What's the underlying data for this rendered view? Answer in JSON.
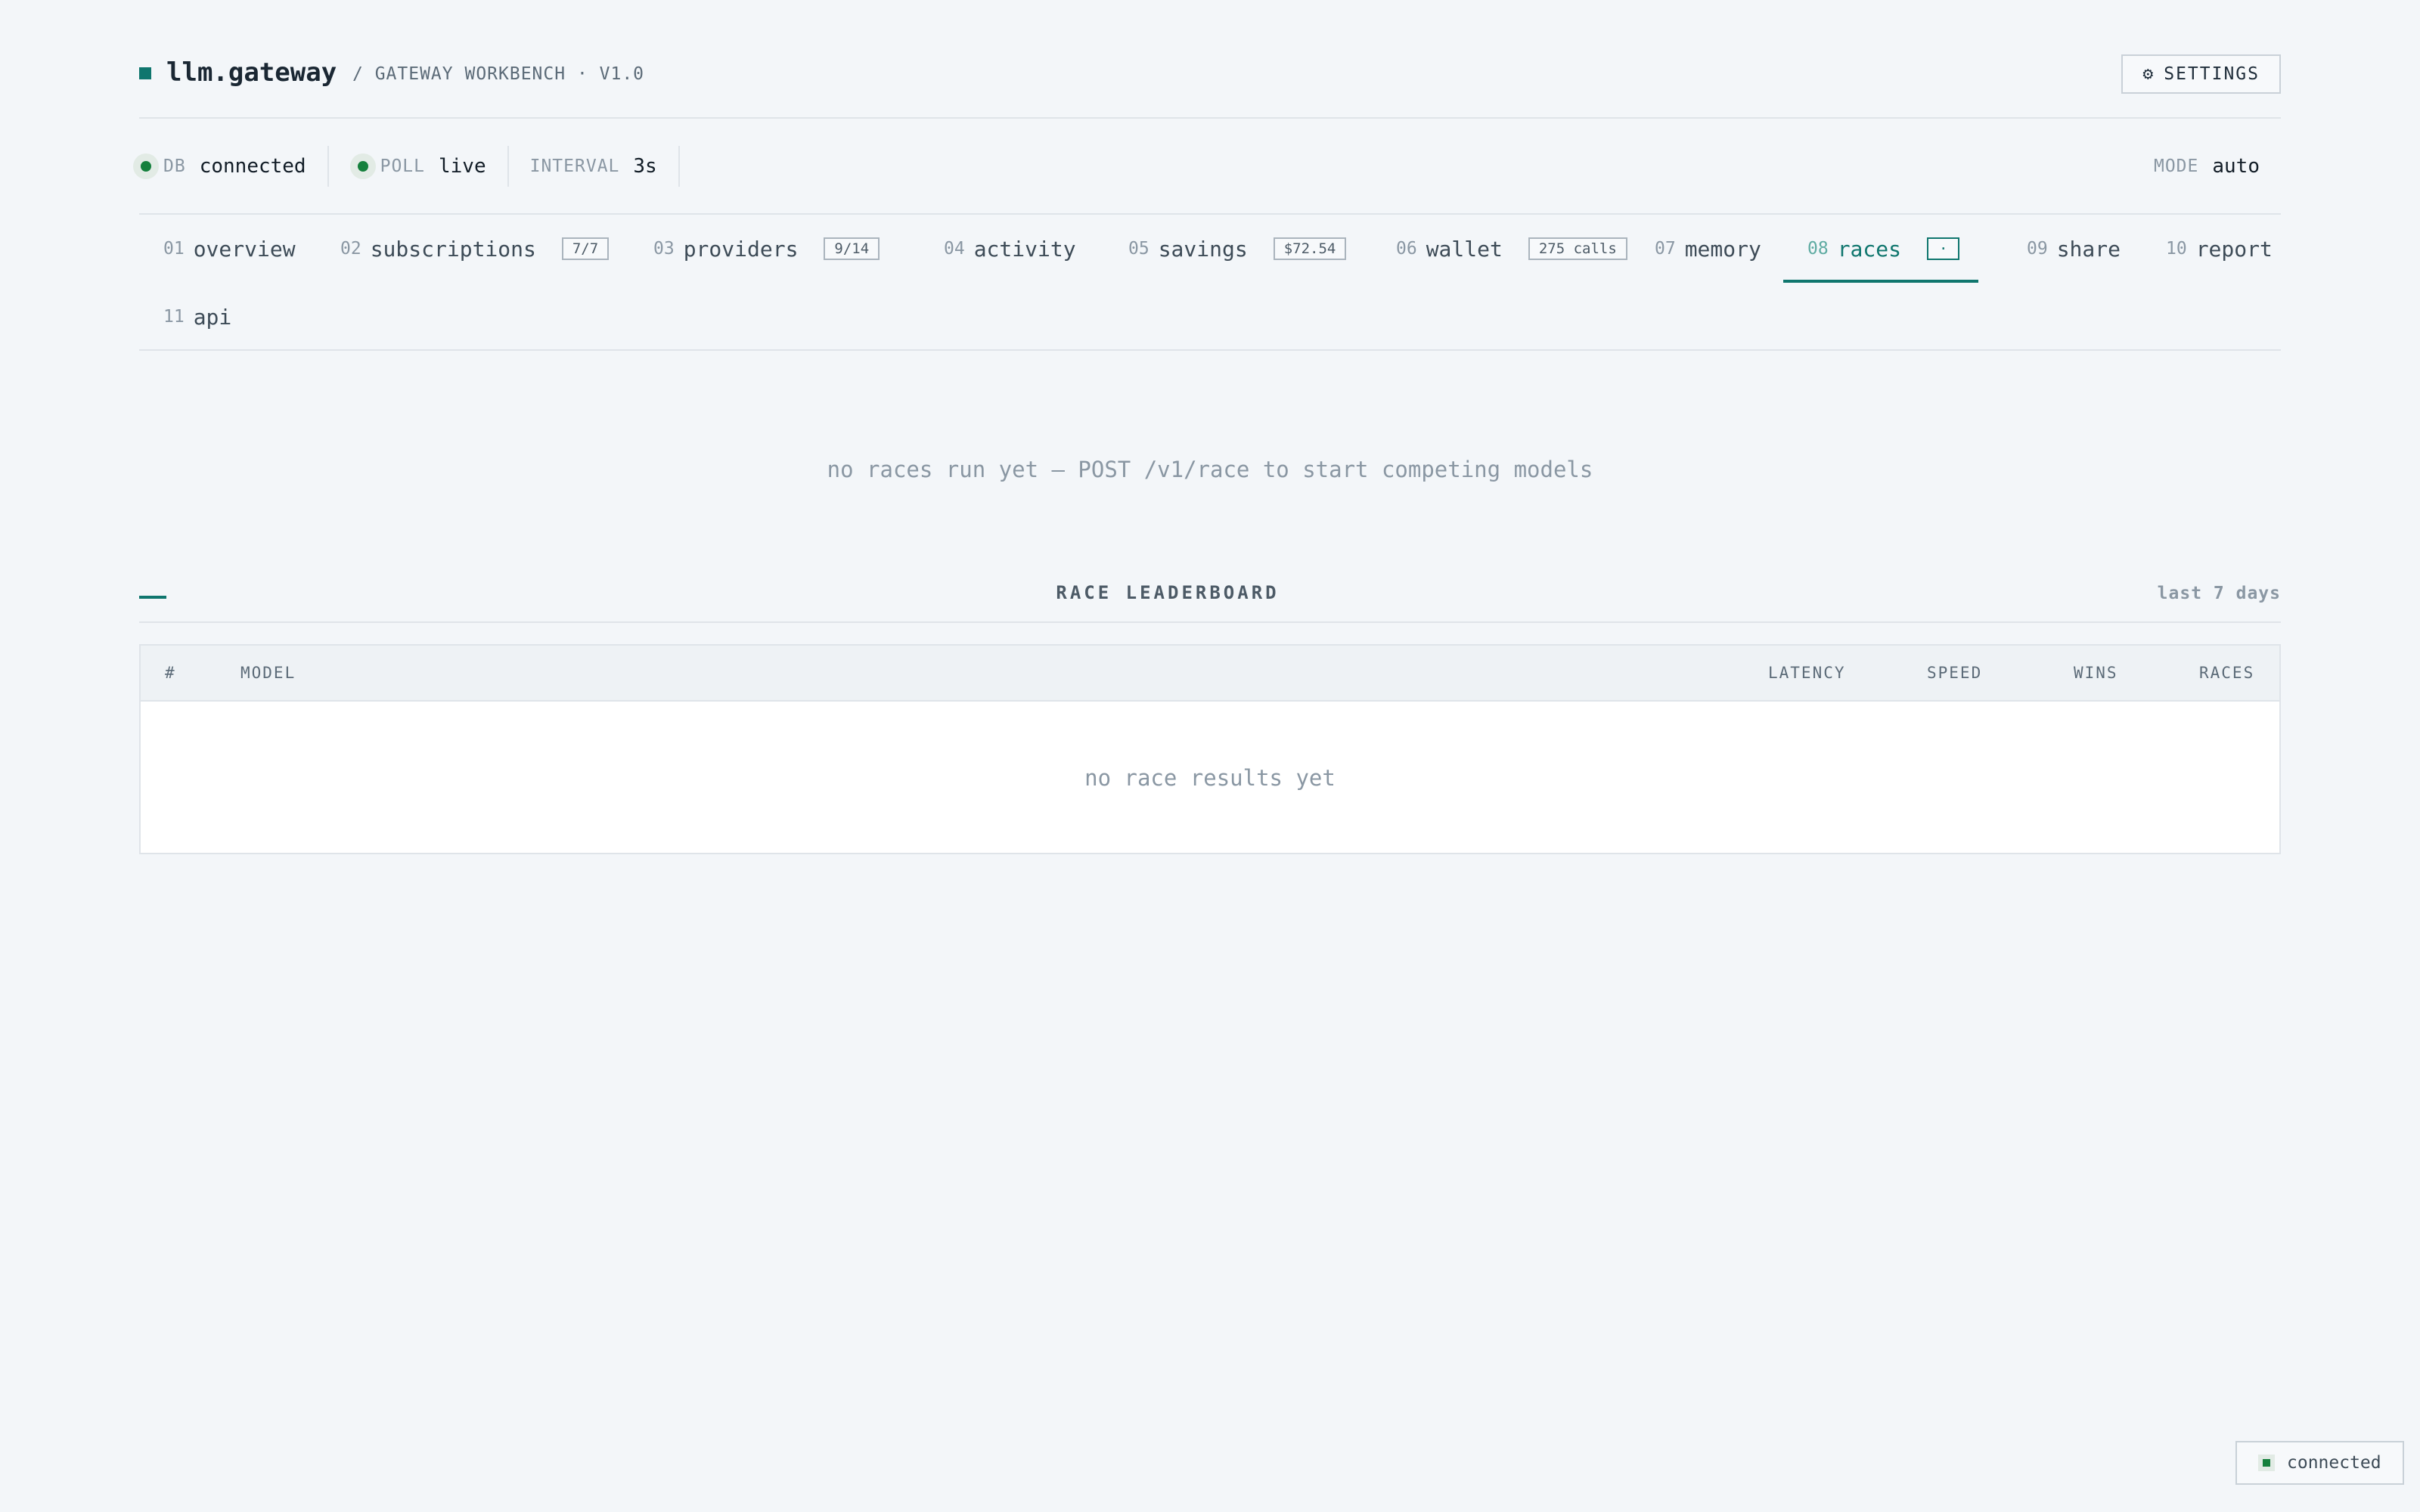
{
  "header": {
    "logo_icon": "square-icon",
    "app_name": "llm.gateway",
    "subtitle": "/ GATEWAY WORKBENCH · V1.0",
    "settings_icon": "gear-icon",
    "settings_glyph": "⚙",
    "settings_label": "SETTINGS"
  },
  "status": {
    "db": {
      "label": "DB",
      "value": "connected"
    },
    "poll": {
      "label": "POLL",
      "value": "live"
    },
    "interval": {
      "label": "INTERVAL",
      "value": "3s"
    },
    "mode": {
      "label": "MODE",
      "value": "auto"
    }
  },
  "tabs": [
    {
      "num": "01",
      "label": "overview",
      "badge": ""
    },
    {
      "num": "02",
      "label": "subscriptions",
      "badge": "7/7"
    },
    {
      "num": "03",
      "label": "providers",
      "badge": "9/14"
    },
    {
      "num": "04",
      "label": "activity",
      "badge": ""
    },
    {
      "num": "05",
      "label": "savings",
      "badge": "$72.54"
    },
    {
      "num": "06",
      "label": "wallet",
      "badge": "275 calls"
    },
    {
      "num": "07",
      "label": "memory",
      "badge": ""
    },
    {
      "num": "08",
      "label": "races",
      "badge": "·"
    },
    {
      "num": "09",
      "label": "share",
      "badge": ""
    },
    {
      "num": "10",
      "label": "report",
      "badge": ""
    },
    {
      "num": "11",
      "label": "api",
      "badge": ""
    }
  ],
  "active_tab": "races",
  "races": {
    "empty_message": "no races run yet — POST /v1/race to start competing models"
  },
  "leaderboard": {
    "title": "RACE LEADERBOARD",
    "range": "last 7 days",
    "columns": {
      "rank": "#",
      "model": "MODEL",
      "latency": "LATENCY",
      "speed": "SPEED",
      "wins": "WINS",
      "races": "RACES"
    },
    "empty_message": "no race results yet"
  },
  "toast": {
    "text": "connected"
  },
  "colors": {
    "accent": "#0f766e",
    "status_ok": "#15803d",
    "background": "#f3f6f9"
  }
}
